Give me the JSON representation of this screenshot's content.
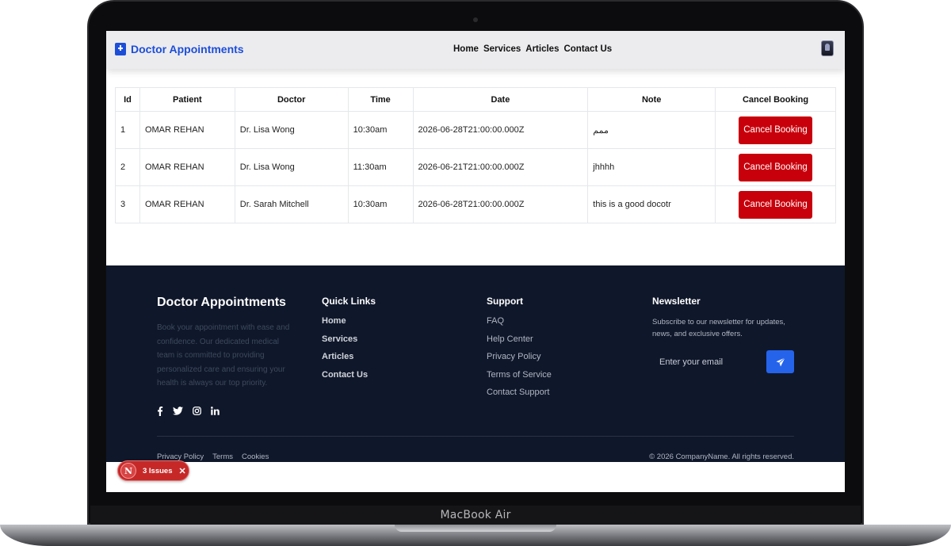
{
  "device": {
    "label": "MacBook Air"
  },
  "header": {
    "logo_text": "Doctor Appointments",
    "nav": [
      "Home",
      "Services",
      "Articles",
      "Contact Us"
    ]
  },
  "table": {
    "headers": [
      "Id",
      "Patient",
      "Doctor",
      "Time",
      "Date",
      "Note",
      "Cancel Booking"
    ],
    "rows": [
      {
        "id": "1",
        "patient": "OMAR REHAN",
        "doctor": "Dr. Lisa Wong",
        "time": "10:30am",
        "date": "2026-06-28T21:00:00.000Z",
        "note": "ممم",
        "action": "Cancel Booking"
      },
      {
        "id": "2",
        "patient": "OMAR REHAN",
        "doctor": "Dr. Lisa Wong",
        "time": "11:30am",
        "date": "2026-06-21T21:00:00.000Z",
        "note": "jhhhh",
        "action": "Cancel Booking"
      },
      {
        "id": "3",
        "patient": "OMAR REHAN",
        "doctor": "Dr. Sarah Mitchell",
        "time": "10:30am",
        "date": "2026-06-28T21:00:00.000Z",
        "note": "this is a good docotr",
        "action": "Cancel Booking"
      }
    ]
  },
  "footer": {
    "brand": {
      "title": "Doctor Appointments",
      "description": "Book your appointment with ease and confidence. Our dedicated medical team is committed to providing personalized care and ensuring your health is always our top priority."
    },
    "socials": [
      "facebook-icon",
      "twitter-icon",
      "instagram-icon",
      "linkedin-icon"
    ],
    "quick_links": {
      "title": "Quick Links",
      "items": [
        "Home",
        "Services",
        "Articles",
        "Contact Us"
      ]
    },
    "support": {
      "title": "Support",
      "items": [
        "FAQ",
        "Help Center",
        "Privacy Policy",
        "Terms of Service",
        "Contact Support"
      ]
    },
    "newsletter": {
      "title": "Newsletter",
      "text": "Subscribe to our newsletter for updates, news, and exclusive offers.",
      "placeholder": "Enter your email",
      "button_icon": "send-icon"
    },
    "bottom_links": [
      "Privacy Policy",
      "Terms",
      "Cookies"
    ],
    "copyright": "© 2026 CompanyName. All rights reserved."
  },
  "issues_badge": {
    "logo": "N",
    "text": "3 Issues",
    "close": "✕"
  },
  "colors": {
    "accent": "#1d4ed8",
    "danger": "#c8000b",
    "footer_bg": "#0f172a",
    "newsletter_btn": "#2563eb"
  }
}
